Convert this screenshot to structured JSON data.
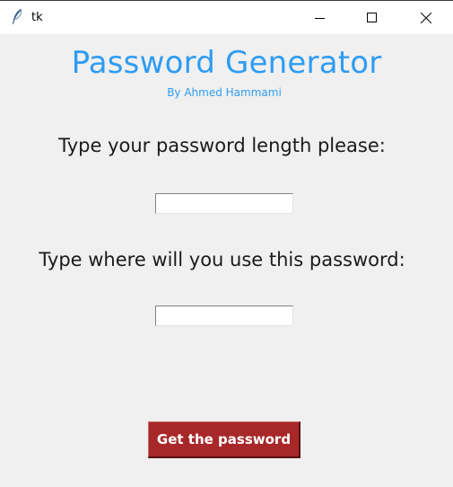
{
  "window": {
    "title": "tk",
    "icon": "feather-icon"
  },
  "controls": {
    "minimize_icon": "minimize-icon",
    "maximize_icon": "maximize-icon",
    "close_icon": "close-icon"
  },
  "header": {
    "title": "Password Generator",
    "subtitle": "By Ahmed Hammami",
    "accent_color": "#2e9cf2"
  },
  "form": {
    "length_label": "Type your password length please:",
    "length_value": "",
    "usage_label": "Type where will you use this password:",
    "usage_value": "",
    "submit_label": "Get the password",
    "submit_color": "#a8282a"
  }
}
